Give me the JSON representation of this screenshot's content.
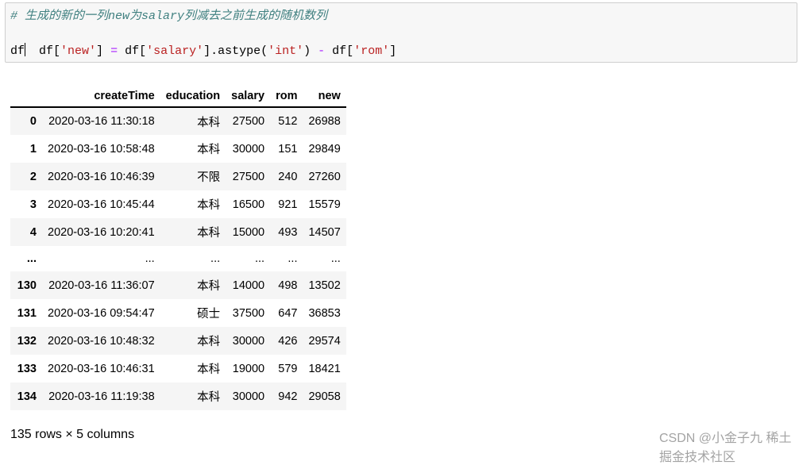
{
  "code": {
    "comment": "# 生成的新的一列new为salary列减去之前生成的随机数列",
    "line2_parts": [
      "df[",
      "'new'",
      "] ",
      "=",
      " df[",
      "'salary'",
      "].astype(",
      "'int'",
      ") ",
      "-",
      " df[",
      "'rom'",
      "]"
    ],
    "line3": "df"
  },
  "table": {
    "columns": [
      "createTime",
      "education",
      "salary",
      "rom",
      "new"
    ],
    "rows": [
      {
        "index": "0",
        "cells": [
          "2020-03-16 11:30:18",
          "本科",
          "27500",
          "512",
          "26988"
        ]
      },
      {
        "index": "1",
        "cells": [
          "2020-03-16 10:58:48",
          "本科",
          "30000",
          "151",
          "29849"
        ]
      },
      {
        "index": "2",
        "cells": [
          "2020-03-16 10:46:39",
          "不限",
          "27500",
          "240",
          "27260"
        ]
      },
      {
        "index": "3",
        "cells": [
          "2020-03-16 10:45:44",
          "本科",
          "16500",
          "921",
          "15579"
        ]
      },
      {
        "index": "4",
        "cells": [
          "2020-03-16 10:20:41",
          "本科",
          "15000",
          "493",
          "14507"
        ]
      },
      {
        "index": "...",
        "cells": [
          "...",
          "...",
          "...",
          "...",
          "..."
        ]
      },
      {
        "index": "130",
        "cells": [
          "2020-03-16 11:36:07",
          "本科",
          "14000",
          "498",
          "13502"
        ]
      },
      {
        "index": "131",
        "cells": [
          "2020-03-16 09:54:47",
          "硕士",
          "37500",
          "647",
          "36853"
        ]
      },
      {
        "index": "132",
        "cells": [
          "2020-03-16 10:48:32",
          "本科",
          "30000",
          "426",
          "29574"
        ]
      },
      {
        "index": "133",
        "cells": [
          "2020-03-16 10:46:31",
          "本科",
          "19000",
          "579",
          "18421"
        ]
      },
      {
        "index": "134",
        "cells": [
          "2020-03-16 11:19:38",
          "本科",
          "30000",
          "942",
          "29058"
        ]
      }
    ]
  },
  "footer": "135 rows × 5 columns",
  "watermark": "CSDN @小金子九 稀土掘金技术社区"
}
